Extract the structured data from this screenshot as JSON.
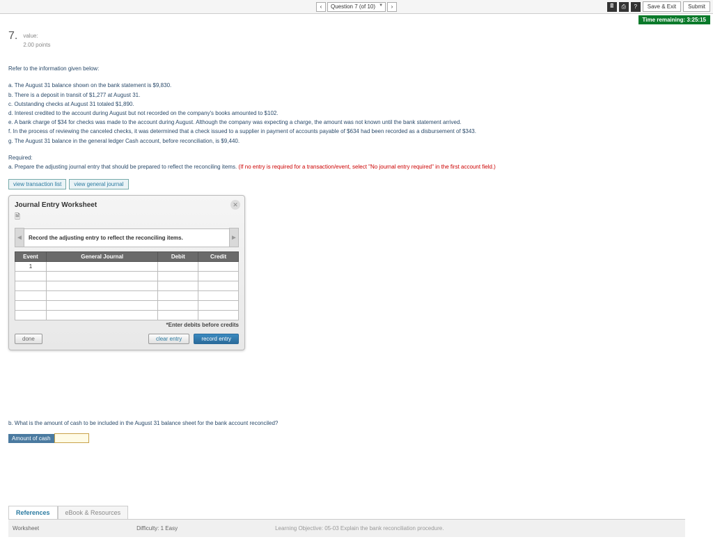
{
  "topbar": {
    "question_selector": "Question 7 (of 10)",
    "save_exit": "Save & Exit",
    "submit": "Submit"
  },
  "timer": "Time remaining: 3:25:15",
  "question": {
    "number": "7.",
    "points_label": "value:",
    "points": "2.00 points",
    "intro": "Refer to the information given below:",
    "lines": {
      "a": "a. The August 31 balance shown on the bank statement is $9,830.",
      "b": "b. There is a deposit in transit of $1,277 at August 31.",
      "c": "c. Outstanding checks at August 31 totaled $1,890.",
      "d": "d. Interest credited to the account during August but not recorded on the company's books amounted to $102.",
      "e": "e. A bank charge of $34 for checks was made to the account during August. Although the company was expecting a charge, the amount was not known until the bank statement arrived.",
      "f": "f. In the process of reviewing the canceled checks, it was determined that a check issued to a supplier in payment of accounts payable of $634 had been recorded as a disbursement of $343.",
      "g": "g. The August 31 balance in the general ledger Cash account, before reconciliation, is $9,440."
    },
    "required_label": "Required:",
    "req_a_1": "a. Prepare the adjusting journal entry that should be prepared to reflect the reconciling items. ",
    "req_a_red": "(If no entry is required for a transaction/event, select \"No journal entry required\" in the first account field.)"
  },
  "links": {
    "txn_list": "view transaction list",
    "gen_journal": "view general journal"
  },
  "worksheet": {
    "title": "Journal Entry Worksheet",
    "instruction": "Record the adjusting entry to reflect the reconciling items.",
    "cols": {
      "event": "Event",
      "gj": "General Journal",
      "debit": "Debit",
      "credit": "Credit"
    },
    "row1_event": "1",
    "hint": "*Enter debits before credits",
    "done": "done",
    "clear": "clear entry",
    "record": "record entry"
  },
  "partb": {
    "text": "b. What is the amount of cash to be included in the August 31 balance sheet for the bank account reconciled?",
    "label": "Amount of cash"
  },
  "lower": {
    "tab1": "References",
    "tab2": "eBook & Resources",
    "worksheet": "Worksheet",
    "difficulty": "Difficulty: 1 Easy",
    "lo": "Learning Objective: 05-03 Explain the bank reconciliation procedure."
  }
}
